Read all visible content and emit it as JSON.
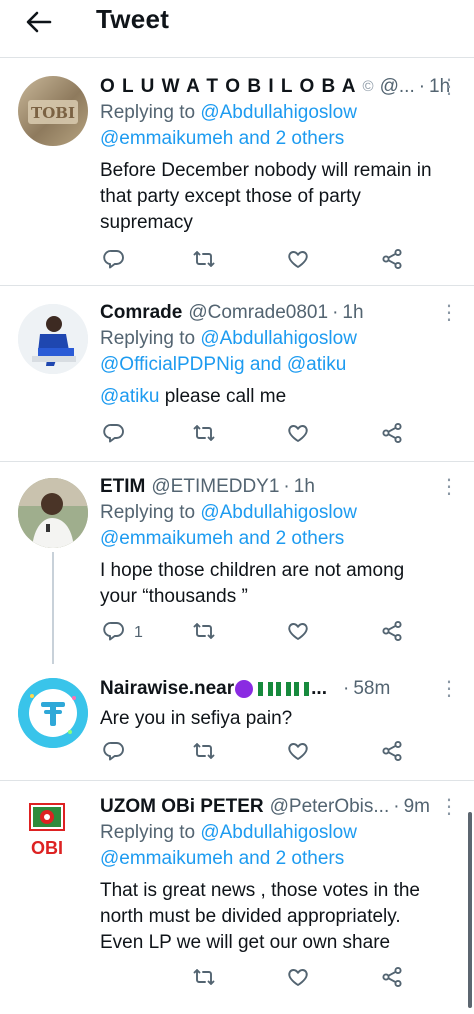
{
  "header": {
    "title": "Tweet"
  },
  "tweets": [
    {
      "name": "O L U W A T O B I L O B A",
      "badge": "©",
      "handle": "@...",
      "time": "1h",
      "replying_label": "Replying to",
      "reply_line1": "@Abdullahigoslow",
      "reply_line2": "@emmaikumeh and 2 others",
      "text_lines": [
        "Before December nobody will remain in",
        "that party except those of party",
        "supremacy"
      ],
      "reply_count": ""
    },
    {
      "name": "Comrade",
      "handle": "@Comrade0801",
      "time": "1h",
      "replying_label": "Replying to",
      "reply_line1": "@Abdullahigoslow",
      "reply_line2": "@OfficialPDPNig and @atiku",
      "text_mention": "@atiku",
      "text_rest": " please call me",
      "reply_count": ""
    },
    {
      "name": "ETIM",
      "handle": "@ETIMEDDY1",
      "time": "1h",
      "replying_label": "Replying to",
      "reply_line1": "@Abdullahigoslow",
      "reply_line2": "@emmaikumeh and 2 others",
      "text_lines": [
        "I hope those children are not among",
        "your “thousands ”"
      ],
      "reply_count": "1"
    },
    {
      "name": "Nairawise.near",
      "name_suffix": "...",
      "time": "58m",
      "text_lines": [
        "Are you in sefiya pain?"
      ],
      "reply_count": ""
    },
    {
      "name": "UZOM OBi PETER",
      "handle": "@PeterObis...",
      "time": "9m",
      "avatar_text": "OBI",
      "replying_label": "Replying to",
      "reply_line1": "@Abdullahigoslow",
      "reply_line2": "@emmaikumeh and 2 others",
      "text_lines": [
        "That is great news , those votes in the",
        "north must be divided appropriately.",
        "Even LP we will get our own share"
      ],
      "reply_count": ""
    }
  ],
  "colors": {
    "link": "#1d9bf0",
    "muted": "#536471",
    "text": "#0f1419"
  },
  "icons": [
    "back-arrow-icon",
    "reply-icon",
    "retweet-icon",
    "like-icon",
    "share-icon",
    "more-icon",
    "purple-circle-emoji-icon",
    "nigeria-flag-icon",
    "verified-icon"
  ]
}
